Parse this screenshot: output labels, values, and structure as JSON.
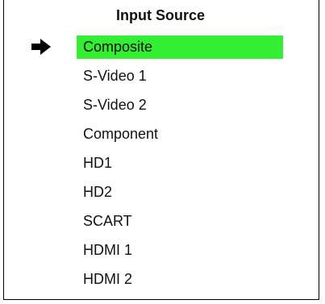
{
  "menu": {
    "title": "Input Source",
    "pointer_icon": "right-arrow-icon",
    "selected_index": 0,
    "highlight_color": "#33ee33",
    "options": [
      {
        "label": "Composite"
      },
      {
        "label": "S-Video 1"
      },
      {
        "label": "S-Video 2"
      },
      {
        "label": "Component"
      },
      {
        "label": "HD1"
      },
      {
        "label": "HD2"
      },
      {
        "label": "SCART"
      },
      {
        "label": "HDMI 1"
      },
      {
        "label": "HDMI 2"
      }
    ]
  }
}
